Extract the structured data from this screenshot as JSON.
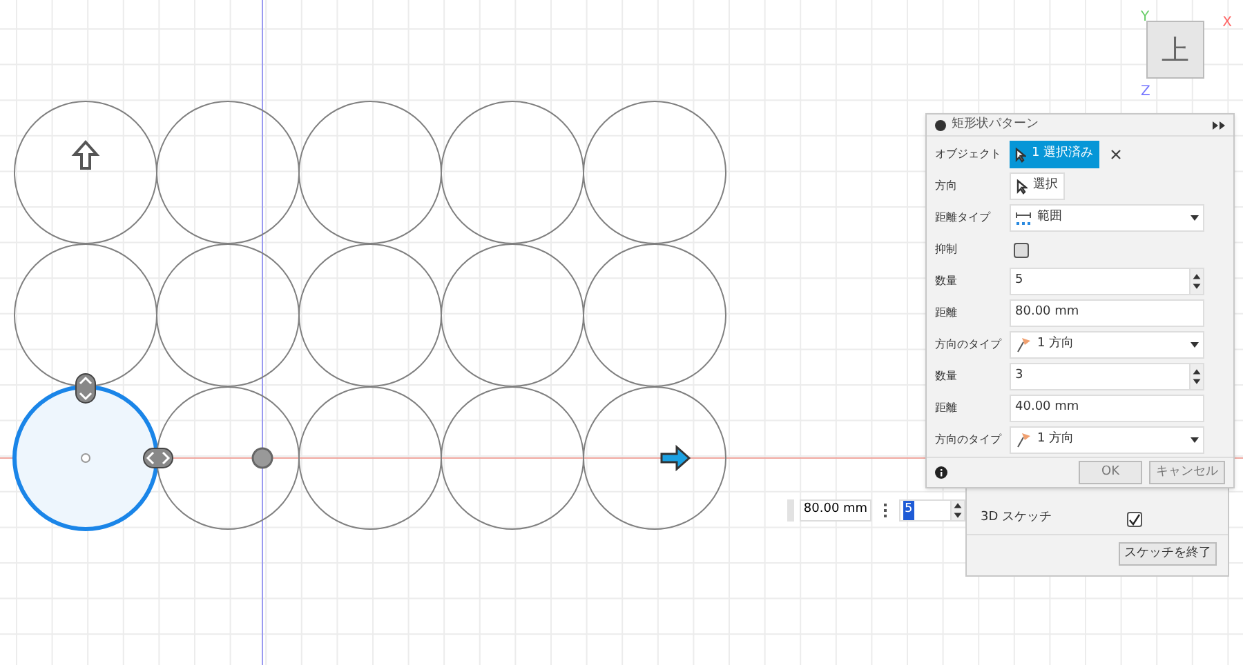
{
  "view_cube": {
    "face": "上",
    "axes": [
      "Y",
      "X",
      "Z"
    ]
  },
  "sketch": {
    "rows": [
      [
        {
          "selected": false
        },
        {
          "selected": false
        },
        {
          "selected": false
        },
        {
          "selected": false
        },
        {
          "selected": false
        }
      ],
      [
        {
          "selected": false
        },
        {
          "selected": false
        },
        {
          "selected": false
        },
        {
          "selected": false
        },
        {
          "selected": false
        }
      ],
      [
        {
          "selected": true
        },
        {
          "selected": false
        },
        {
          "selected": false
        },
        {
          "selected": false
        },
        {
          "selected": false
        }
      ]
    ]
  },
  "dialog": {
    "title": "矩形状パターン",
    "rows": [
      {
        "kind": "selection",
        "label": "オブジェクト",
        "value": "1 選択済み",
        "selected": true
      },
      {
        "kind": "button",
        "label": "方向",
        "value": "選択"
      },
      {
        "kind": "range",
        "label": "距離タイプ",
        "value": "範囲"
      },
      {
        "kind": "checkbox",
        "label": "抑制",
        "checked": false
      },
      {
        "kind": "spinner",
        "label": "数量",
        "value": "5"
      },
      {
        "kind": "text",
        "label": "距離",
        "value": "80.00 mm"
      },
      {
        "kind": "direction",
        "label": "方向のタイプ",
        "value": "1 方向"
      },
      {
        "kind": "spinner",
        "label": "数量",
        "value": "3"
      },
      {
        "kind": "text",
        "label": "距離",
        "value": "40.00 mm"
      },
      {
        "kind": "direction",
        "label": "方向のタイプ",
        "value": "1 方向"
      }
    ],
    "buttons": [
      "OK",
      "キャンセル"
    ]
  },
  "inline_inputs": {
    "distance": "80.00 mm",
    "count": "5"
  },
  "sketch_palette": {
    "rows": [
      {
        "label": "3D スケッチ",
        "checked": true
      }
    ],
    "finish_button": "スケッチを終了"
  }
}
